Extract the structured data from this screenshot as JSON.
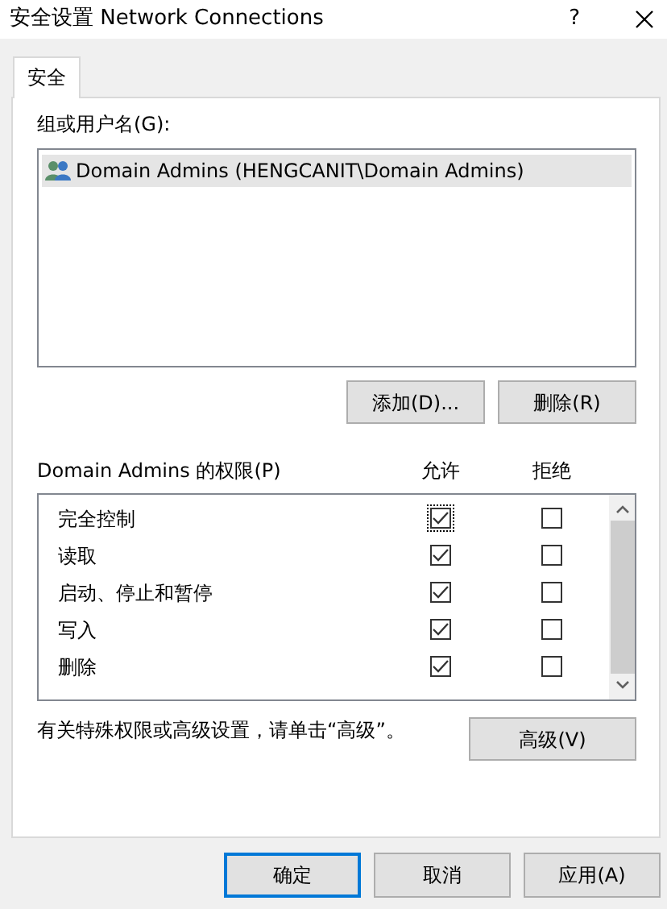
{
  "window": {
    "title": "安全设置 Network Connections",
    "help": "?"
  },
  "tabs": [
    {
      "label": "安全",
      "selected": true
    }
  ],
  "groups": {
    "label": "组或用户名(G):",
    "items": [
      {
        "name": "Domain Admins (HENGCANIT\\Domain Admins)",
        "selected": true
      }
    ]
  },
  "group_buttons": [
    "添加(D)...",
    "删除(R)"
  ],
  "permissions": {
    "label": "Domain Admins 的权限(P)",
    "columns": [
      "允许",
      "拒绝"
    ],
    "rows": [
      {
        "name": "完全控制",
        "allow": true,
        "deny": false,
        "focused": true
      },
      {
        "name": "读取",
        "allow": true,
        "deny": false,
        "focused": false
      },
      {
        "name": "启动、停止和暂停",
        "allow": true,
        "deny": false,
        "focused": false
      },
      {
        "name": "写入",
        "allow": true,
        "deny": false,
        "focused": false
      },
      {
        "name": "删除",
        "allow": true,
        "deny": false,
        "focused": false
      }
    ]
  },
  "advanced": {
    "text": "有关特殊权限或高级设置，请单击“高级”。",
    "button": "高级(V)"
  },
  "buttons": [
    {
      "label": "确定",
      "default": true
    },
    {
      "label": "取消",
      "default": false
    },
    {
      "label": "应用(A)",
      "default": false
    }
  ]
}
